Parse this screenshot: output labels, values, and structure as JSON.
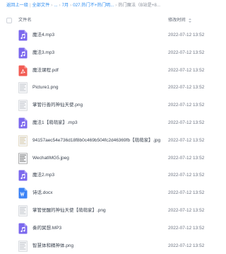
{
  "breadcrumb": {
    "items": [
      "返回上一级",
      "全部文件",
      "...",
      "7月",
      "027.热门不+热门明...",
      "热门魔法（B站是+8..."
    ],
    "separator": "|"
  },
  "header": {
    "name_col": "文件名",
    "date_col": "修改时间"
  },
  "files": [
    {
      "name": "魔法4.mp3",
      "date": "2022-07-12 13:52",
      "icon": "audio-file-icon",
      "color": "#7b68ee"
    },
    {
      "name": "魔法3.mp3",
      "date": "2022-07-12 13:52",
      "icon": "audio-file-icon",
      "color": "#7b68ee"
    },
    {
      "name": "魔法课程.pdf",
      "date": "2022-07-12 13:52",
      "icon": "pdf-file-icon",
      "color": "#f25c54"
    },
    {
      "name": "Picture1.png",
      "date": "2022-07-12 13:52",
      "icon": "image-thumbnail-icon",
      "color": "#c4c8ce"
    },
    {
      "name": "掌管行善的神仙天使.png",
      "date": "2022-07-12 13:52",
      "icon": "image-thumbnail-icon",
      "color": "#c4c8ce"
    },
    {
      "name": "魔法1【萌萌家】.mp3",
      "date": "2022-07-12 13:52",
      "icon": "audio-file-icon",
      "color": "#7b68ee"
    },
    {
      "name": "94157aec54e736d18f8b0c469b504fc2d46369fb【萌萌家】.jpg",
      "date": "2022-07-12 13:52",
      "icon": "image-thumbnail-icon",
      "color": "#d8c9a6"
    },
    {
      "name": "WechatIMG5.jpeg",
      "date": "2022-07-12 13:52",
      "icon": "image-thumbnail-icon",
      "color": "#7a7a7a"
    },
    {
      "name": "魔法2.mp3",
      "date": "2022-07-12 13:52",
      "icon": "audio-file-icon",
      "color": "#7b68ee"
    },
    {
      "name": "诗话.docx",
      "date": "2022-07-12 13:52",
      "icon": "word-file-icon",
      "color": "#3b82f6"
    },
    {
      "name": "掌管觉醒的神仙天使【萌萌家】.png",
      "date": "2022-07-12 13:52",
      "icon": "image-thumbnail-icon",
      "color": "#c4c8ce"
    },
    {
      "name": "奏的冥想.MP3",
      "date": "2022-07-12 13:52",
      "icon": "audio-file-icon",
      "color": "#7b68ee"
    },
    {
      "name": "智慧体和精神体.png",
      "date": "2022-07-12 13:52",
      "icon": "image-thumbnail-icon",
      "color": "#c4c8ce"
    }
  ]
}
